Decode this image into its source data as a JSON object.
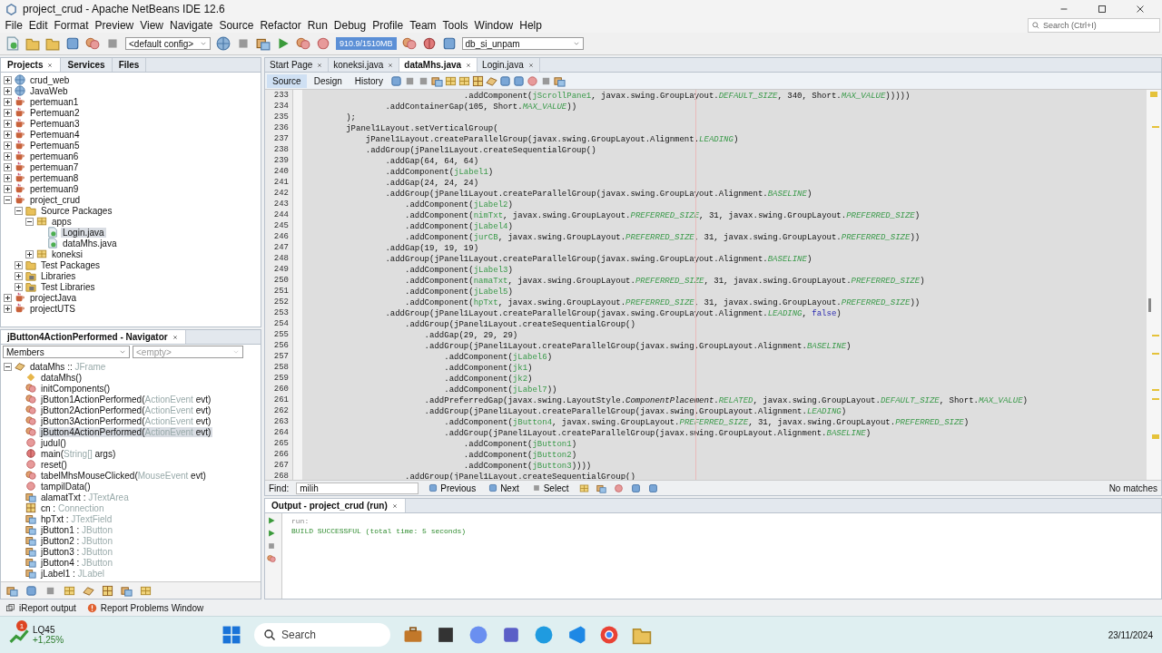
{
  "window": {
    "title": "project_crud - Apache NetBeans IDE 12.6"
  },
  "menu": [
    "File",
    "Edit",
    "Format",
    "Preview",
    "View",
    "Navigate",
    "Source",
    "Refactor",
    "Run",
    "Debug",
    "Profile",
    "Team",
    "Tools",
    "Window",
    "Help"
  ],
  "search": {
    "placeholder": "Search (Ctrl+I)"
  },
  "toolbar": {
    "config": "<default config>",
    "memory": "910.9/1510MB",
    "database": "db_si_unpam"
  },
  "projects": {
    "tabs": [
      {
        "label": "Projects",
        "selected": true
      },
      {
        "label": "Services",
        "selected": false
      },
      {
        "label": "Files",
        "selected": false
      }
    ],
    "tree": [
      {
        "label": "crud_web",
        "kind": "web-project",
        "expanded": false,
        "selected": false
      },
      {
        "label": "JavaWeb",
        "kind": "web-project",
        "expanded": false,
        "selected": false
      },
      {
        "label": "pertemuan1",
        "kind": "project",
        "expanded": false,
        "selected": false
      },
      {
        "label": "Pertemuan2",
        "kind": "project",
        "expanded": false,
        "selected": false
      },
      {
        "label": "Pertemuan3",
        "kind": "project",
        "expanded": false,
        "selected": false
      },
      {
        "label": "Pertemuan4",
        "kind": "project",
        "expanded": false,
        "selected": false
      },
      {
        "label": "Pertemuan5",
        "kind": "project",
        "expanded": false,
        "selected": false
      },
      {
        "label": "pertemuan6",
        "kind": "project",
        "expanded": false,
        "selected": false
      },
      {
        "label": "pertemuan7",
        "kind": "project",
        "expanded": false,
        "selected": false
      },
      {
        "label": "pertemuan8",
        "kind": "project",
        "expanded": false,
        "selected": false
      },
      {
        "label": "pertemuan9",
        "kind": "project",
        "expanded": false,
        "selected": false
      },
      {
        "label": "project_crud",
        "kind": "project",
        "expanded": true,
        "selected": false,
        "children": [
          {
            "label": "Source Packages",
            "kind": "source-folder",
            "expanded": true,
            "selected": false,
            "children": [
              {
                "label": "apps",
                "kind": "package",
                "expanded": true,
                "selected": false,
                "children": [
                  {
                    "label": "Login.java",
                    "kind": "java-file",
                    "selected": true
                  },
                  {
                    "label": "dataMhs.java",
                    "kind": "java-file",
                    "selected": false
                  }
                ]
              },
              {
                "label": "koneksi",
                "kind": "package",
                "expanded": false,
                "selected": false
              }
            ]
          },
          {
            "label": "Test Packages",
            "kind": "source-folder",
            "expanded": false,
            "selected": false
          },
          {
            "label": "Libraries",
            "kind": "library-folder",
            "expanded": false,
            "selected": false
          },
          {
            "label": "Test Libraries",
            "kind": "library-folder",
            "expanded": false,
            "selected": false
          }
        ]
      },
      {
        "label": "projectJava",
        "kind": "project",
        "expanded": false,
        "selected": false
      },
      {
        "label": "projectUTS",
        "kind": "project",
        "expanded": false,
        "selected": false
      }
    ]
  },
  "navigator": {
    "title": "jButton4ActionPerformed - Navigator",
    "filter": "Members",
    "filter_2": "<empty>",
    "tree": [
      {
        "label": "dataMhs :: ",
        "type": "JFrame",
        "kind": "class",
        "expanded": true,
        "selected": false,
        "children": [
          {
            "label": "dataMhs()",
            "kind": "constructor",
            "selected": false
          },
          {
            "label": "initComponents()",
            "kind": "private-method",
            "selected": false
          },
          {
            "label": "jButton1ActionPerformed(",
            "type": "ActionEvent",
            "suffix": " evt)",
            "kind": "private-method",
            "selected": false
          },
          {
            "label": "jButton2ActionPerformed(",
            "type": "ActionEvent",
            "suffix": " evt)",
            "kind": "private-method",
            "selected": false
          },
          {
            "label": "jButton3ActionPerformed(",
            "type": "ActionEvent",
            "suffix": " evt)",
            "kind": "private-method",
            "selected": false
          },
          {
            "label": "jButton4ActionPerformed(",
            "type": "ActionEvent",
            "suffix": " evt)",
            "kind": "private-method",
            "selected": true
          },
          {
            "label": "judul()",
            "kind": "method",
            "selected": false
          },
          {
            "label": "main(",
            "type": "String[]",
            "suffix": " args)",
            "kind": "static-method",
            "selected": false
          },
          {
            "label": "reset()",
            "kind": "method",
            "selected": false
          },
          {
            "label": "tabelMhsMouseClicked(",
            "type": "MouseEvent",
            "suffix": " evt)",
            "kind": "private-method",
            "selected": false
          },
          {
            "label": "tampilData()",
            "kind": "method",
            "selected": false
          },
          {
            "label": "alamatTxt : ",
            "type": "JTextArea",
            "kind": "component-field",
            "selected": false
          },
          {
            "label": "cn : ",
            "type": "Connection",
            "kind": "field",
            "selected": false
          },
          {
            "label": "hpTxt : ",
            "type": "JTextField",
            "kind": "component-field",
            "selected": false
          },
          {
            "label": "jButton1 : ",
            "type": "JButton",
            "kind": "component-field",
            "selected": false
          },
          {
            "label": "jButton2 : ",
            "type": "JButton",
            "kind": "component-field",
            "selected": false
          },
          {
            "label": "jButton3 : ",
            "type": "JButton",
            "kind": "component-field",
            "selected": false
          },
          {
            "label": "jButton4 : ",
            "type": "JButton",
            "kind": "component-field",
            "selected": false
          },
          {
            "label": "jLabel1 : ",
            "type": "JLabel",
            "kind": "component-field",
            "selected": false
          }
        ]
      }
    ]
  },
  "editor": {
    "tabs": [
      {
        "label": "Start Page",
        "selected": false
      },
      {
        "label": "koneksi.java",
        "selected": false
      },
      {
        "label": "dataMhs.java",
        "selected": true
      },
      {
        "label": "Login.java",
        "selected": false
      }
    ],
    "views": [
      {
        "label": "Source",
        "selected": true
      },
      {
        "label": "Design",
        "selected": false
      },
      {
        "label": "History",
        "selected": false
      }
    ],
    "lines": [
      {
        "number": "233",
        "code": [
          {
            "text": "                                .addComponent(",
            "kind": "plain"
          },
          {
            "text": "jScrollPane1",
            "kind": "field"
          },
          {
            "text": ", javax.swing.GroupLayout.",
            "kind": "plain"
          },
          {
            "text": "DEFAULT_SIZE",
            "kind": "constant"
          },
          {
            "text": ", 340, Short.",
            "kind": "plain"
          },
          {
            "text": "MAX_VALUE",
            "kind": "constant"
          },
          {
            "text": ")))))",
            "kind": "plain"
          }
        ]
      },
      {
        "number": "234",
        "code": [
          {
            "text": "                .addContainerGap(105, Short.",
            "kind": "plain"
          },
          {
            "text": "MAX_VALUE",
            "kind": "constant"
          },
          {
            "text": "))",
            "kind": "plain"
          }
        ]
      },
      {
        "number": "235",
        "code": [
          {
            "text": "        );",
            "kind": "plain"
          }
        ]
      },
      {
        "number": "236",
        "code": [
          {
            "text": "        jPanel1Layout.setVerticalGroup(",
            "kind": "plain"
          }
        ]
      },
      {
        "number": "237",
        "code": [
          {
            "text": "            jPanel1Layout.createParallelGroup(javax.swing.GroupLayout.Alignment.",
            "kind": "plain"
          },
          {
            "text": "LEADING",
            "kind": "constant"
          },
          {
            "text": ")",
            "kind": "plain"
          }
        ]
      },
      {
        "number": "238",
        "code": [
          {
            "text": "            .addGroup(jPanel1Layout.createSequentialGroup()",
            "kind": "plain"
          }
        ]
      },
      {
        "number": "239",
        "code": [
          {
            "text": "                .addGap(64, 64, 64)",
            "kind": "plain"
          }
        ]
      },
      {
        "number": "240",
        "code": [
          {
            "text": "                .addComponent(",
            "kind": "plain"
          },
          {
            "text": "jLabel1",
            "kind": "field"
          },
          {
            "text": ")",
            "kind": "plain"
          }
        ]
      },
      {
        "number": "241",
        "code": [
          {
            "text": "                .addGap(24, 24, 24)",
            "kind": "plain"
          }
        ]
      },
      {
        "number": "242",
        "code": [
          {
            "text": "                .addGroup(jPanel1Layout.createParallelGroup(javax.swing.GroupLayout.Alignment.",
            "kind": "plain"
          },
          {
            "text": "BASELINE",
            "kind": "constant"
          },
          {
            "text": ")",
            "kind": "plain"
          }
        ]
      },
      {
        "number": "243",
        "code": [
          {
            "text": "                    .addComponent(",
            "kind": "plain"
          },
          {
            "text": "jLabel2",
            "kind": "field"
          },
          {
            "text": ")",
            "kind": "plain"
          }
        ]
      },
      {
        "number": "244",
        "code": [
          {
            "text": "                    .addComponent(",
            "kind": "plain"
          },
          {
            "text": "nimTxt",
            "kind": "field"
          },
          {
            "text": ", javax.swing.GroupLayout.",
            "kind": "plain"
          },
          {
            "text": "PREFERRED_SIZE",
            "kind": "constant"
          },
          {
            "text": ", 31, javax.swing.GroupLayout.",
            "kind": "plain"
          },
          {
            "text": "PREFERRED_SIZE",
            "kind": "constant"
          },
          {
            "text": ")",
            "kind": "plain"
          }
        ]
      },
      {
        "number": "245",
        "code": [
          {
            "text": "                    .addComponent(",
            "kind": "plain"
          },
          {
            "text": "jLabel4",
            "kind": "field"
          },
          {
            "text": ")",
            "kind": "plain"
          }
        ]
      },
      {
        "number": "246",
        "code": [
          {
            "text": "                    .addComponent(",
            "kind": "plain"
          },
          {
            "text": "jurCB",
            "kind": "field"
          },
          {
            "text": ", javax.swing.GroupLayout.",
            "kind": "plain"
          },
          {
            "text": "PREFERRED_SIZE",
            "kind": "constant"
          },
          {
            "text": ", 31, javax.swing.GroupLayout.",
            "kind": "plain"
          },
          {
            "text": "PREFERRED_SIZE",
            "kind": "constant"
          },
          {
            "text": "))",
            "kind": "plain"
          }
        ]
      },
      {
        "number": "247",
        "code": [
          {
            "text": "                .addGap(19, 19, 19)",
            "kind": "plain"
          }
        ]
      },
      {
        "number": "248",
        "code": [
          {
            "text": "                .addGroup(jPanel1Layout.createParallelGroup(javax.swing.GroupLayout.Alignment.",
            "kind": "plain"
          },
          {
            "text": "BASELINE",
            "kind": "constant"
          },
          {
            "text": ")",
            "kind": "plain"
          }
        ]
      },
      {
        "number": "249",
        "code": [
          {
            "text": "                    .addComponent(",
            "kind": "plain"
          },
          {
            "text": "jLabel3",
            "kind": "field"
          },
          {
            "text": ")",
            "kind": "plain"
          }
        ]
      },
      {
        "number": "250",
        "code": [
          {
            "text": "                    .addComponent(",
            "kind": "plain"
          },
          {
            "text": "namaTxt",
            "kind": "field"
          },
          {
            "text": ", javax.swing.GroupLayout.",
            "kind": "plain"
          },
          {
            "text": "PREFERRED_SIZE",
            "kind": "constant"
          },
          {
            "text": ", 31, javax.swing.GroupLayout.",
            "kind": "plain"
          },
          {
            "text": "PREFERRED_SIZE",
            "kind": "constant"
          },
          {
            "text": ")",
            "kind": "plain"
          }
        ]
      },
      {
        "number": "251",
        "code": [
          {
            "text": "                    .addComponent(",
            "kind": "plain"
          },
          {
            "text": "jLabel5",
            "kind": "field"
          },
          {
            "text": ")",
            "kind": "plain"
          }
        ]
      },
      {
        "number": "252",
        "code": [
          {
            "text": "                    .addComponent(",
            "kind": "plain"
          },
          {
            "text": "hpTxt",
            "kind": "field"
          },
          {
            "text": ", javax.swing.GroupLayout.",
            "kind": "plain"
          },
          {
            "text": "PREFERRED_SIZE",
            "kind": "constant"
          },
          {
            "text": ", 31, javax.swing.GroupLayout.",
            "kind": "plain"
          },
          {
            "text": "PREFERRED_SIZE",
            "kind": "constant"
          },
          {
            "text": "))",
            "kind": "plain"
          }
        ]
      },
      {
        "number": "253",
        "code": [
          {
            "text": "                .addGroup(jPanel1Layout.createParallelGroup(javax.swing.GroupLayout.Alignment.",
            "kind": "plain"
          },
          {
            "text": "LEADING",
            "kind": "constant"
          },
          {
            "text": ", ",
            "kind": "plain"
          },
          {
            "text": "false",
            "kind": "keyword"
          },
          {
            "text": ")",
            "kind": "plain"
          }
        ]
      },
      {
        "number": "254",
        "code": [
          {
            "text": "                    .addGroup(jPanel1Layout.createSequentialGroup()",
            "kind": "plain"
          }
        ]
      },
      {
        "number": "255",
        "code": [
          {
            "text": "                        .addGap(29, 29, 29)",
            "kind": "plain"
          }
        ]
      },
      {
        "number": "256",
        "code": [
          {
            "text": "                        .addGroup(jPanel1Layout.createParallelGroup(javax.swing.GroupLayout.Alignment.",
            "kind": "plain"
          },
          {
            "text": "BASELINE",
            "kind": "constant"
          },
          {
            "text": ")",
            "kind": "plain"
          }
        ]
      },
      {
        "number": "257",
        "code": [
          {
            "text": "                            .addComponent(",
            "kind": "plain"
          },
          {
            "text": "jLabel6",
            "kind": "field"
          },
          {
            "text": ")",
            "kind": "plain"
          }
        ]
      },
      {
        "number": "258",
        "code": [
          {
            "text": "                            .addComponent(",
            "kind": "plain"
          },
          {
            "text": "jk1",
            "kind": "field"
          },
          {
            "text": ")",
            "kind": "plain"
          }
        ]
      },
      {
        "number": "259",
        "code": [
          {
            "text": "                            .addComponent(",
            "kind": "plain"
          },
          {
            "text": "jk2",
            "kind": "field"
          },
          {
            "text": ")",
            "kind": "plain"
          }
        ]
      },
      {
        "number": "260",
        "code": [
          {
            "text": "                            .addComponent(",
            "kind": "plain"
          },
          {
            "text": "jLabel7",
            "kind": "field"
          },
          {
            "text": "))",
            "kind": "plain"
          }
        ]
      },
      {
        "number": "261",
        "code": [
          {
            "text": "                        .addPreferredGap(javax.swing.LayoutStyle.",
            "kind": "plain"
          },
          {
            "text": "ComponentPlacement",
            "kind": "italic"
          },
          {
            "text": ".",
            "kind": "plain"
          },
          {
            "text": "RELATED",
            "kind": "constant"
          },
          {
            "text": ", javax.swing.GroupLayout.",
            "kind": "plain"
          },
          {
            "text": "DEFAULT_SIZE",
            "kind": "constant"
          },
          {
            "text": ", Short.",
            "kind": "plain"
          },
          {
            "text": "MAX_VALUE",
            "kind": "constant"
          },
          {
            "text": ")",
            "kind": "plain"
          }
        ]
      },
      {
        "number": "262",
        "code": [
          {
            "text": "                        .addGroup(jPanel1Layout.createParallelGroup(javax.swing.GroupLayout.Alignment.",
            "kind": "plain"
          },
          {
            "text": "LEADING",
            "kind": "constant"
          },
          {
            "text": ")",
            "kind": "plain"
          }
        ]
      },
      {
        "number": "263",
        "code": [
          {
            "text": "                            .addComponent(",
            "kind": "plain"
          },
          {
            "text": "jButton4",
            "kind": "field"
          },
          {
            "text": ", javax.swing.GroupLayout.",
            "kind": "plain"
          },
          {
            "text": "PREFERRED_SIZE",
            "kind": "constant"
          },
          {
            "text": ", 31, javax.swing.GroupLayout.",
            "kind": "plain"
          },
          {
            "text": "PREFERRED_SIZE",
            "kind": "constant"
          },
          {
            "text": ")",
            "kind": "plain"
          }
        ]
      },
      {
        "number": "264",
        "code": [
          {
            "text": "                            .addGroup(jPanel1Layout.createParallelGroup(javax.swing.GroupLayout.Alignment.",
            "kind": "plain"
          },
          {
            "text": "BASELINE",
            "kind": "constant"
          },
          {
            "text": ")",
            "kind": "plain"
          }
        ]
      },
      {
        "number": "265",
        "code": [
          {
            "text": "                                .addComponent(",
            "kind": "plain"
          },
          {
            "text": "jButton1",
            "kind": "field"
          },
          {
            "text": ")",
            "kind": "plain"
          }
        ]
      },
      {
        "number": "266",
        "code": [
          {
            "text": "                                .addComponent(",
            "kind": "plain"
          },
          {
            "text": "jButton2",
            "kind": "field"
          },
          {
            "text": ")",
            "kind": "plain"
          }
        ]
      },
      {
        "number": "267",
        "code": [
          {
            "text": "                                .addComponent(",
            "kind": "plain"
          },
          {
            "text": "jButton3",
            "kind": "field"
          },
          {
            "text": "))))",
            "kind": "plain"
          }
        ]
      },
      {
        "number": "268",
        "code": [
          {
            "text": "                    .addGroup(jPanel1Layout.createSequentialGroup()",
            "kind": "plain"
          }
        ]
      }
    ],
    "find": {
      "label": "Find:",
      "value": "milih",
      "buttons": [
        "Previous",
        "Next",
        "Select"
      ],
      "status": "No matches"
    }
  },
  "output": {
    "title": "Output - project_crud (run)",
    "lines": [
      {
        "text": "run:",
        "kind": "info"
      },
      {
        "text": "BUILD SUCCESSFUL (total time: 5 seconds)",
        "kind": "success"
      }
    ]
  },
  "status_bar": {
    "items": [
      "iReport output",
      "Report Problems Window"
    ]
  },
  "taskbar": {
    "widget": {
      "badge": "1",
      "title": "LQ45",
      "change": "+1,25%"
    },
    "search": {
      "placeholder": "Search"
    },
    "date": "23/11/2024"
  }
}
